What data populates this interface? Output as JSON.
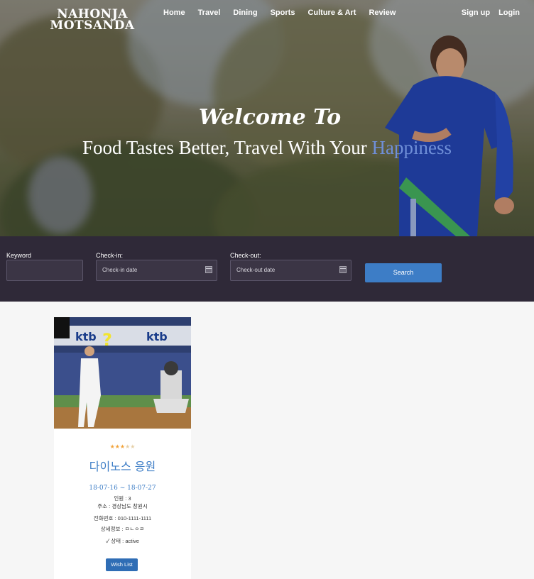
{
  "header": {
    "logo_line1": "NAHONJA",
    "logo_line2": "MOTSANDA",
    "nav": [
      "Home",
      "Travel",
      "Dining",
      "Sports",
      "Culture & Art",
      "Review"
    ],
    "signup": "Sign up",
    "login": "Login"
  },
  "hero": {
    "welcome": "Welcome To",
    "tagline_main": "Food Tastes Better, Travel With Your ",
    "tagline_highlight": "Happiness",
    "highlight_color": "#6f8fd8"
  },
  "search": {
    "keyword_label": "Keyword",
    "keyword_value": "",
    "checkin_label": "Check-in:",
    "checkin_placeholder": "Check-in date",
    "checkout_label": "Check-out:",
    "checkout_placeholder": "Check-out date",
    "button": "Search",
    "bar_color": "#2f2938",
    "button_color": "#3d7dc6"
  },
  "card": {
    "rating": 3,
    "rating_max": 5,
    "title": "다이노스 응원",
    "dates": "18-07-16 ~ 18-07-27",
    "people": "인원 : 3",
    "address": "주소 :  경상남도 창원시",
    "phone": "전화번호 :  010-1111-1111",
    "details": "상세정보 :   ㅁㄴㅇㄹ",
    "status": "상태 : active",
    "wish_button": "Wish List",
    "image_text_left": "ktb",
    "image_text_right": "ktb"
  }
}
